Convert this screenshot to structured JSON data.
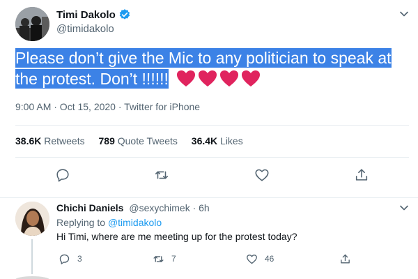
{
  "tweet": {
    "author": {
      "name": "Timi Dakolo",
      "handle": "@timidakolo",
      "avatar_icon": "profile-photo-icon",
      "verified_icon": "verified-badge-icon"
    },
    "text_line1": "Please don’t give the Mic to any politician to speak at",
    "text_line2": "the protest. Don’t !!!!!!",
    "emoji": "red-heart-icon ×4",
    "timestamp": "9:00 AM · Oct 15, 2020 · Twitter for iPhone",
    "stats": {
      "retweets_count": "38.6K",
      "retweets_label": "Retweets",
      "quotes_count": "789",
      "quotes_label": "Quote Tweets",
      "likes_count": "36.4K",
      "likes_label": "Likes"
    },
    "actions": [
      "reply-icon",
      "retweet-icon",
      "like-icon",
      "share-icon"
    ]
  },
  "reply": {
    "author": {
      "name": "Chichi Daniels",
      "handle": "@sexychimek",
      "age": "· 6h"
    },
    "replying_prefix": "Replying to",
    "replying_to": "@timidakolo",
    "text": "Hi Timi, where are me meeting up for the protest today?",
    "counts": {
      "replies": "3",
      "retweets": "7",
      "likes": "46"
    }
  },
  "colors": {
    "highlight": "#3c82e6",
    "heart": "#e0245e",
    "muted": "#536471",
    "link": "#1d9bf0",
    "verified": "#1d9bf0"
  }
}
